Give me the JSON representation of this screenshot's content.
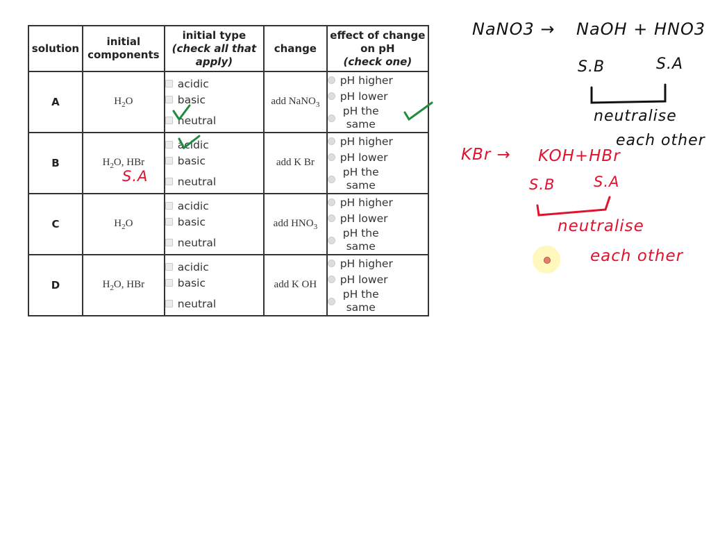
{
  "table": {
    "headers": {
      "solution": "solution",
      "components": "initial components",
      "type_line1": "initial type",
      "type_line2": "(check all that apply)",
      "change": "change",
      "effect_line1": "effect of change on pH",
      "effect_line2": "(check one)"
    },
    "type_options": [
      "acidic",
      "basic",
      "neutral"
    ],
    "effect_options": [
      "pH higher",
      "pH lower",
      "pH the same"
    ],
    "rows": [
      {
        "solution": "A",
        "comp_main": "H",
        "comp_sub": "2",
        "comp_rest": "O",
        "change_main": "add NaNO",
        "change_sub": "3",
        "checked_type": "neutral",
        "checked_effect": "pH the same"
      },
      {
        "solution": "B",
        "comp_main": "H",
        "comp_sub": "2",
        "comp_rest": "O, HBr",
        "change_main": "add K Br",
        "change_sub": "",
        "checked_type": "acidic",
        "checked_effect": ""
      },
      {
        "solution": "C",
        "comp_main": "H",
        "comp_sub": "2",
        "comp_rest": "O",
        "change_main": "add HNO",
        "change_sub": "3",
        "checked_type": "",
        "checked_effect": ""
      },
      {
        "solution": "D",
        "comp_main": "H",
        "comp_sub": "2",
        "comp_rest": "O, HBr",
        "change_main": "add K OH",
        "change_sub": "",
        "checked_type": "",
        "checked_effect": ""
      }
    ]
  },
  "annotations": {
    "black": {
      "eq1_left": "NaNO3 →",
      "eq1_right": "NaOH + HNO3",
      "sb": "S.B",
      "sa": "S.A",
      "neutralise": "neutralise",
      "each_other": "each other"
    },
    "red": {
      "row_b_note": "S.A",
      "eq2_left": "KBr →",
      "eq2_right": "KOH+HBr",
      "sb": "S.B",
      "sa": "S.A",
      "neutralise": "neutralise",
      "each_other": "each other"
    },
    "colors": {
      "check_mark": "#1e8a3c",
      "red_ink": "#e0122e",
      "black_ink": "#111111"
    }
  }
}
